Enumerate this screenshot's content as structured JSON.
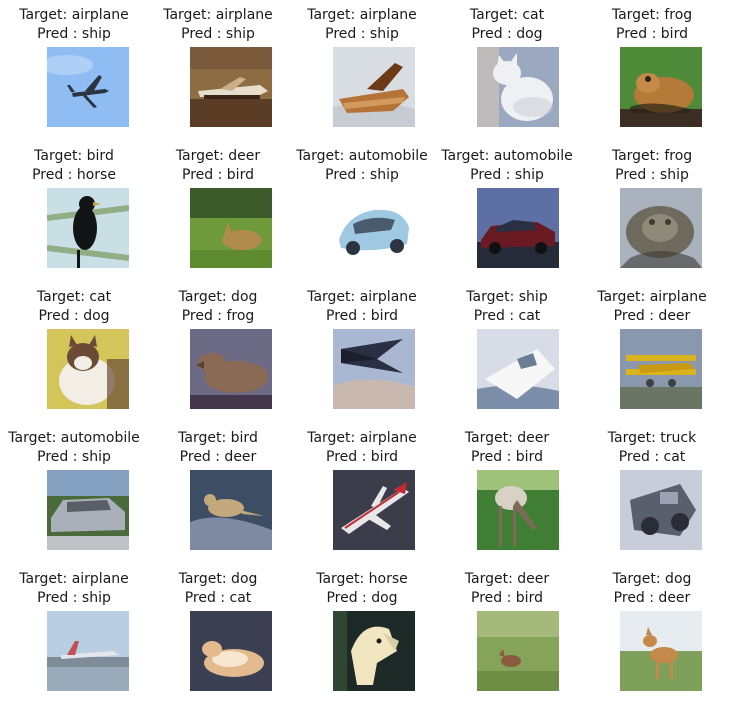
{
  "grid": {
    "columns": 5,
    "cells": [
      {
        "target": "Target: airplane",
        "pred": "Pred : ship",
        "image": "airplane-sky-icon",
        "scene": "airplane-sky",
        "palette": [
          "#8fbcf2",
          "#b7d4f6",
          "#2b3440"
        ]
      },
      {
        "target": "Target: airplane",
        "pred": "Pred : ship",
        "image": "airplane-ground-icon",
        "scene": "airplane-ground",
        "palette": [
          "#8d6b43",
          "#5b3d25",
          "#e7ddcc"
        ]
      },
      {
        "target": "Target: airplane",
        "pred": "Pred : ship",
        "image": "airplane-wood-icon",
        "scene": "airplane-wood",
        "palette": [
          "#d8dde4",
          "#b57437",
          "#6d3a17"
        ]
      },
      {
        "target": "Target: cat",
        "pred": "Pred : dog",
        "image": "cat-white-icon",
        "scene": "cat-white",
        "palette": [
          "#9aa9c0",
          "#eef0f4",
          "#c9c9d1"
        ]
      },
      {
        "target": "Target: frog",
        "pred": "Pred : bird",
        "image": "frog-icon",
        "scene": "frog",
        "palette": [
          "#4f8a38",
          "#b37a38",
          "#2c2218"
        ]
      },
      {
        "target": "Target: bird",
        "pred": "Pred : horse",
        "image": "bird-dark-icon",
        "scene": "bird-dark",
        "palette": [
          "#c9dfe6",
          "#7a9a5b",
          "#121416"
        ]
      },
      {
        "target": "Target: deer",
        "pred": "Pred : bird",
        "image": "deer-grass-icon",
        "scene": "deer-grass",
        "palette": [
          "#6f9a3c",
          "#b08b4b",
          "#3d5a2a"
        ]
      },
      {
        "target": "Target: automobile",
        "pred": "Pred : ship",
        "image": "automobile-blue-icon",
        "scene": "automobile-blue",
        "palette": [
          "#ffffff",
          "#9fc8e3",
          "#4a5b6e"
        ]
      },
      {
        "target": "Target: automobile",
        "pred": "Pred : ship",
        "image": "automobile-red-icon",
        "scene": "automobile-red",
        "palette": [
          "#5e6fa6",
          "#6a1a23",
          "#262b3a"
        ]
      },
      {
        "target": "Target: frog",
        "pred": "Pred : ship",
        "image": "frog-rock-icon",
        "scene": "frog-rock",
        "palette": [
          "#aab2bd",
          "#6e6a5e",
          "#3b3a35"
        ]
      },
      {
        "target": "Target: cat",
        "pred": "Pred : dog",
        "image": "cat-grass-icon",
        "scene": "cat-grass",
        "palette": [
          "#d4c55a",
          "#f2eee6",
          "#6b4a36"
        ]
      },
      {
        "target": "Target: dog",
        "pred": "Pred : frog",
        "image": "dog-lying-icon",
        "scene": "dog-lying",
        "palette": [
          "#6d6a86",
          "#8a6a54",
          "#44364a"
        ]
      },
      {
        "target": "Target: airplane",
        "pred": "Pred : bird",
        "image": "airplane-stealth-icon",
        "scene": "airplane-stealth",
        "palette": [
          "#aab7d2",
          "#2b2f44",
          "#c9b8b0"
        ]
      },
      {
        "target": "Target: ship",
        "pred": "Pred : cat",
        "image": "ship-boat-icon",
        "scene": "ship-boat",
        "palette": [
          "#d8dce6",
          "#f7f7f7",
          "#7b8da8"
        ]
      },
      {
        "target": "Target: airplane",
        "pred": "Pred : deer",
        "image": "airplane-biplane-icon",
        "scene": "airplane-biplane",
        "palette": [
          "#8a98ad",
          "#d9b21c",
          "#3e4140"
        ]
      },
      {
        "target": "Target: automobile",
        "pred": "Pred : ship",
        "image": "automobile-silver-icon",
        "scene": "automobile-silver",
        "palette": [
          "#4a6a3c",
          "#aab0ba",
          "#5a5e66"
        ]
      },
      {
        "target": "Target: bird",
        "pred": "Pred : deer",
        "image": "bird-rock-icon",
        "scene": "bird-rock",
        "palette": [
          "#3c4d64",
          "#c2a87a",
          "#7d8aa2"
        ]
      },
      {
        "target": "Target: airplane",
        "pred": "Pred : bird",
        "image": "airplane-jet-icon",
        "scene": "airplane-jet",
        "palette": [
          "#3b3e4a",
          "#e8e8ea",
          "#c22c34"
        ]
      },
      {
        "target": "Target: deer",
        "pred": "Pred : bird",
        "image": "deer-grazing-icon",
        "scene": "deer-grazing",
        "palette": [
          "#3f7e34",
          "#d8d2c6",
          "#7d6b57"
        ]
      },
      {
        "target": "Target: truck",
        "pred": "Pred : cat",
        "image": "truck-icon",
        "scene": "truck",
        "palette": [
          "#c7cdd9",
          "#5a5f6e",
          "#2b2d36"
        ]
      },
      {
        "target": "Target: airplane",
        "pred": "Pred : ship",
        "image": "airplane-runway-icon",
        "scene": "airplane-runway",
        "palette": [
          "#b9cde3",
          "#7e8c9a",
          "#c44f4f"
        ]
      },
      {
        "target": "Target: dog",
        "pred": "Pred : cat",
        "image": "dog-light-icon",
        "scene": "dog-light",
        "palette": [
          "#3a3f52",
          "#e3b98e",
          "#f7e6d0"
        ]
      },
      {
        "target": "Target: horse",
        "pred": "Pred : dog",
        "image": "horse-head-icon",
        "scene": "horse-head",
        "palette": [
          "#1d2a28",
          "#f2e6c0",
          "#3a5a3a"
        ]
      },
      {
        "target": "Target: deer",
        "pred": "Pred : bird",
        "image": "deer-field-icon",
        "scene": "deer-field",
        "palette": [
          "#86a35a",
          "#a5b97a",
          "#8c5a3c"
        ]
      },
      {
        "target": "Target: dog",
        "pred": "Pred : deer",
        "image": "dog-standing-icon",
        "scene": "dog-standing",
        "palette": [
          "#e6ecef",
          "#7fa05a",
          "#c58a4a"
        ]
      }
    ]
  }
}
